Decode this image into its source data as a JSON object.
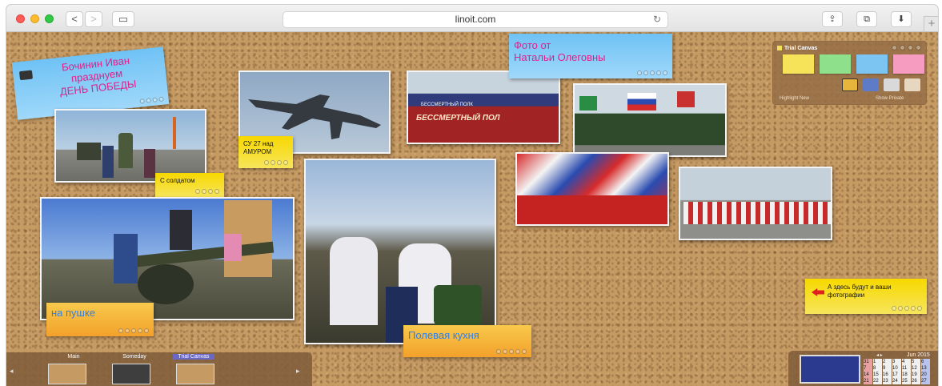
{
  "browser": {
    "url": "linoit.com",
    "nav": {
      "back": "<",
      "forward": ">",
      "sidebar": "▭",
      "reload": "↻"
    },
    "actions": {
      "share": "⇪",
      "tabs": "⧉",
      "download": "⬇",
      "new_tab": "+"
    }
  },
  "stickies": [
    {
      "id": "title",
      "text_line1": "Бочинин Иван",
      "text_line2": "празднуем",
      "text_line3": "ДЕНЬ ПОБЕДЫ",
      "color": "#e0218a"
    },
    {
      "id": "photo-from",
      "text_line1": "Фото от",
      "text_line2": "Натальи Олеговны",
      "color": "#e0218a"
    },
    {
      "id": "su27",
      "text_line1": "СУ 27 над",
      "text_line2": "АМУРОМ"
    },
    {
      "id": "soldier",
      "text": "С солдатом"
    },
    {
      "id": "cannon",
      "text": "на пушке",
      "color": "#2f7fe6"
    },
    {
      "id": "kitchen",
      "text": "Полевая кухня",
      "color": "#2f7fe6"
    },
    {
      "id": "your-photos",
      "text_line1": "А здесь будут и ваши",
      "text_line2": "фотографии"
    }
  ],
  "photo_banner": "БЕССМЕРТНЫЙ ПОЛ",
  "photo_banner_top": "БЕССМЕРТНЫЙ ПОЛК",
  "panel": {
    "title": "Trial Canvas",
    "note_colors": [
      "#f7e35a",
      "#8fe08a",
      "#7cc4f2",
      "#f59cc0"
    ],
    "highlight_label": "Highlight New",
    "show_label": "Show Private"
  },
  "tabs": [
    {
      "label": "Main"
    },
    {
      "label": "Someday"
    },
    {
      "label": "Trial Canvas"
    }
  ],
  "calendar": {
    "month": "Jun 2015",
    "nav": "◂ ▸",
    "rows": [
      [
        "31",
        "1",
        "2",
        "3",
        "4",
        "5",
        "6"
      ],
      [
        "7",
        "8",
        "9",
        "10",
        "11",
        "12",
        "13"
      ],
      [
        "14",
        "15",
        "16",
        "17",
        "18",
        "19",
        "20"
      ],
      [
        "21",
        "22",
        "23",
        "24",
        "25",
        "26",
        "27"
      ]
    ]
  }
}
